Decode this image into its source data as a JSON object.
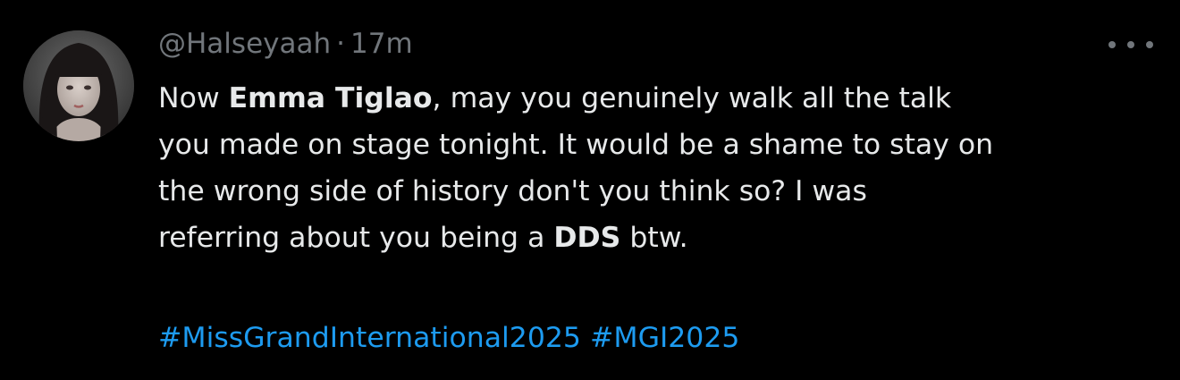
{
  "tweet": {
    "handle": "@Halseyaah",
    "separator": "·",
    "time": "17m",
    "more_icon": "more-dots-icon",
    "avatar_icon": "user-avatar",
    "text_lines": [
      {
        "pre": "Now ",
        "bold": "Emma Tiglao",
        "post": ", may you genuinely walk all the talk"
      },
      {
        "pre": "you made on stage tonight. It would be a shame to stay on",
        "bold": "",
        "post": ""
      },
      {
        "pre": "the wrong side of history don't you think so? I was",
        "bold": "",
        "post": ""
      },
      {
        "pre": "referring about you being a ",
        "bold": "DDS",
        "post": " btw."
      }
    ],
    "hashtags": [
      "#MissGrandInternational2025",
      "#MGI2025"
    ],
    "colors": {
      "background": "#000000",
      "text": "#e7e9ea",
      "muted": "#71767b",
      "link": "#1d9bf0"
    }
  }
}
